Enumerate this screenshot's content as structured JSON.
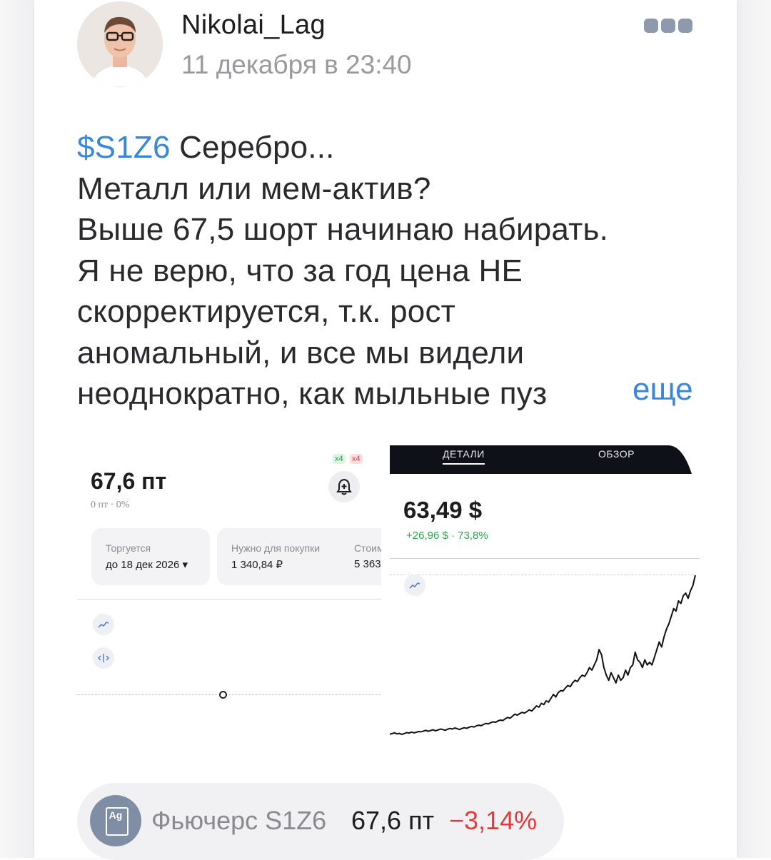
{
  "post": {
    "author": "Nikolai_Lag",
    "date": "11 декабря в 23:40",
    "ticker": "$S1Z6",
    "lines": [
      " Серебро...",
      "Металл или мем-актив?",
      "Выше 67,5 шорт начинаю набирать.",
      "Я не верю, что за год цена НЕ",
      "скорректируется, т.к. рост",
      "аномальный, и все мы видели",
      "неоднократно, как мыльные пуз"
    ],
    "more_label": "еще"
  },
  "left_shot": {
    "price": "67,6 пт",
    "change": "0 пт · 0%",
    "badge_green": "x4",
    "badge_red": "x4",
    "card1_label": "Торгуется",
    "card1_value": "до 18 дек 2026 ▾",
    "card2_label": "Нужно для покупки",
    "card2_value": "1 340,84 ₽",
    "card3_label": "Стоим",
    "card3_value": "5 363"
  },
  "right_shot": {
    "tab_details": "ДЕТАЛИ",
    "tab_overview": "ОБЗОР",
    "price": "63,49 $",
    "change": "+26,96 $ · 73,8%",
    "series": [
      0,
      0.02,
      0.05,
      0.01,
      0.03,
      -0.01,
      0.02,
      0.06,
      0.04,
      0.08,
      0.05,
      0.07,
      0.1,
      0.09,
      0.12,
      0.15,
      0.11,
      0.14,
      0.17,
      0.13,
      0.16,
      0.2,
      0.18,
      0.15,
      0.19,
      0.22,
      0.2,
      0.24,
      0.21,
      0.18,
      0.22,
      0.25,
      0.23,
      0.27,
      0.3,
      0.28,
      0.32,
      0.35,
      0.33,
      0.38,
      0.42,
      0.4,
      0.45,
      0.48,
      0.46,
      0.52,
      0.55,
      0.53,
      0.6,
      0.65,
      0.62,
      0.7,
      0.78,
      0.74,
      0.8,
      0.85,
      0.82,
      0.88,
      0.95,
      0.9,
      1.0,
      1.1,
      1.05,
      1.2,
      1.15,
      1.3,
      1.25,
      1.4,
      1.55,
      1.45,
      1.62,
      1.7,
      1.68,
      1.8,
      1.9,
      1.85,
      2.0,
      2.1,
      2.05,
      2.2,
      2.3,
      2.25,
      2.4,
      2.6,
      2.5,
      2.7,
      2.9,
      3.3,
      3.1,
      2.6,
      2.3,
      2.1,
      2.4,
      2.2,
      2.0,
      2.3,
      2.1,
      2.2,
      2.5,
      2.3,
      2.6,
      2.7,
      3.2,
      2.9,
      2.8,
      2.6,
      2.9,
      2.7,
      2.8,
      2.7,
      3.0,
      3.3,
      3.6,
      3.4,
      3.8,
      4.1,
      4.3,
      4.6,
      4.9,
      4.8,
      5.2,
      5.1,
      5.4,
      5.5,
      5.3,
      5.6,
      5.8,
      6.2
    ]
  },
  "pill": {
    "logo_text": "Ag",
    "name": "Фьючерс S1Z6",
    "price": "67,6 пт",
    "percent": "−3,14%"
  },
  "colors": {
    "link": "#3a86d8",
    "negative": "#e23b3b",
    "positive": "#2aa64a"
  }
}
